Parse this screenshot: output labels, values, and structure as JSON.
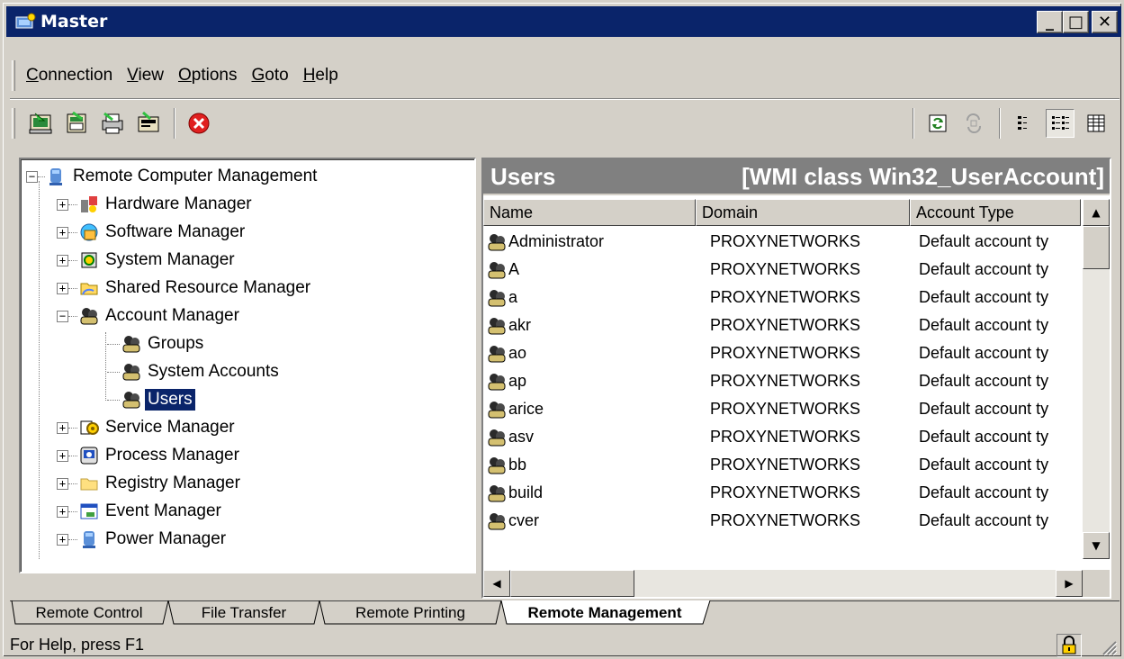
{
  "window": {
    "title": "Master",
    "controls": {
      "minimize": "_",
      "maximize": "□",
      "close": "✕"
    }
  },
  "menu": {
    "items": [
      {
        "key": "C",
        "rest": "onnection"
      },
      {
        "key": "V",
        "rest": "iew"
      },
      {
        "key": "O",
        "rest": "ptions"
      },
      {
        "key": "G",
        "rest": "oto"
      },
      {
        "key": "H",
        "rest": "elp"
      }
    ]
  },
  "toolbar": {
    "left_icons": [
      "connect-icon",
      "disconnect-icon",
      "print-icon",
      "properties-icon",
      "stop-icon"
    ],
    "right_icons": [
      "refresh-icon",
      "refresh-disabled-icon",
      "list-view-icon",
      "details-view-icon",
      "columns-view-icon"
    ]
  },
  "tree": {
    "root": "Remote Computer Management",
    "items": [
      {
        "label": "Hardware Manager",
        "expander": "+"
      },
      {
        "label": "Software Manager",
        "expander": "+"
      },
      {
        "label": "System Manager",
        "expander": "+"
      },
      {
        "label": "Shared Resource Manager",
        "expander": "+"
      },
      {
        "label": "Account Manager",
        "expander": "−"
      },
      {
        "label": "Groups"
      },
      {
        "label": "System Accounts"
      },
      {
        "label": "Users",
        "selected": true
      },
      {
        "label": "Service Manager",
        "expander": "+"
      },
      {
        "label": "Process Manager",
        "expander": "+"
      },
      {
        "label": "Registry Manager",
        "expander": "+"
      },
      {
        "label": "Event Manager",
        "expander": "+"
      },
      {
        "label": "Power Manager",
        "expander": "+"
      }
    ]
  },
  "panel": {
    "title": "Users",
    "subtitle": "[WMI class Win32_UserAccount]",
    "columns": [
      "Name",
      "Domain",
      "Account Type"
    ],
    "rows": [
      [
        "Administrator",
        "PROXYNETWORKS",
        "Default account ty"
      ],
      [
        "A",
        "PROXYNETWORKS",
        "Default account ty"
      ],
      [
        "a",
        "PROXYNETWORKS",
        "Default account ty"
      ],
      [
        "akr",
        "PROXYNETWORKS",
        "Default account ty"
      ],
      [
        "ao",
        "PROXYNETWORKS",
        "Default account ty"
      ],
      [
        "ap",
        "PROXYNETWORKS",
        "Default account ty"
      ],
      [
        "arice",
        "PROXYNETWORKS",
        "Default account ty"
      ],
      [
        "asv",
        "PROXYNETWORKS",
        "Default account ty"
      ],
      [
        "bb",
        "PROXYNETWORKS",
        "Default account ty"
      ],
      [
        "build",
        "PROXYNETWORKS",
        "Default account ty"
      ],
      [
        "cver",
        "PROXYNETWORKS",
        "Default account ty"
      ]
    ]
  },
  "tabs": [
    "Remote Control",
    "File Transfer",
    "Remote Printing",
    "Remote Management"
  ],
  "active_tab": "Remote Management",
  "status": {
    "text": "For Help, press F1"
  },
  "colors": {
    "titlebar": "#0a246a",
    "selection": "#0a246a",
    "face": "#d4d0c8",
    "header": "#808080"
  }
}
